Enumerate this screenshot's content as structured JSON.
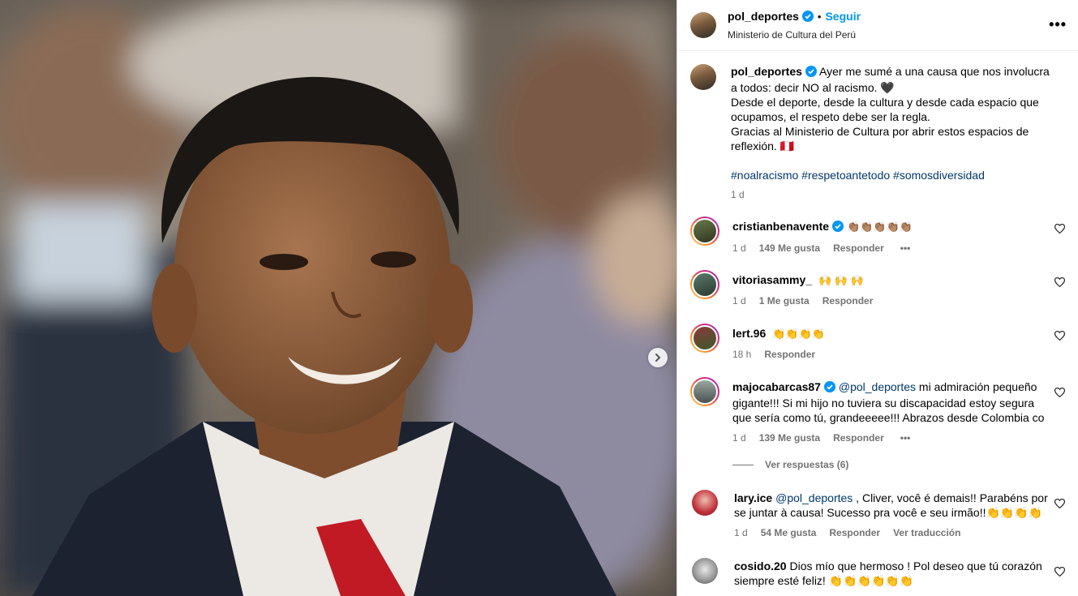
{
  "post": {
    "username": "pol_deportes",
    "follow_label": "Seguir",
    "location": "Ministerio de Cultura del Perú",
    "more_label": "•••"
  },
  "caption": {
    "username": "pol_deportes",
    "line1": "Ayer me sumé a una causa que nos involucra a todos: decir NO al racismo. 🖤",
    "line2": "Desde el deporte, desde la cultura y desde cada espacio que ocupamos, el respeto debe ser la regla.",
    "line3": "Gracias al Ministerio de Cultura por abrir estos espacios de reflexión. 🇵🇪",
    "hashtags": [
      "#noalracismo",
      "#respetoantetodo",
      "#somosdiversidad"
    ],
    "time": "1 d"
  },
  "comments": [
    {
      "username": "cristianbenavente",
      "verified": true,
      "text": "👏🏽👏🏽👏🏽👏🏽👏🏽",
      "time": "1 d",
      "likes": "149 Me gusta",
      "reply": "Responder",
      "more": "•••"
    },
    {
      "username": "vitoriasammy_",
      "verified": false,
      "text": "🙌 🙌 🙌",
      "time": "1 d",
      "likes": "1 Me gusta",
      "reply": "Responder"
    },
    {
      "username": "lert.96",
      "verified": false,
      "text": "👏👏👏👏",
      "time": "18 h",
      "reply": "Responder"
    },
    {
      "username": "majocabarcas87",
      "verified": true,
      "mention": "@pol_deportes",
      "text": " mi admiración pequeño gigante!!! Si mi hijo no tuviera su discapacidad estoy segura que sería como tú, grandeeeee!!! Abrazos desde Colombia co",
      "time": "1 d",
      "likes": "139 Me gusta",
      "reply": "Responder",
      "more": "•••"
    },
    {
      "username": "lary.ice",
      "verified": false,
      "mention": "@pol_deportes",
      "text": " , Cliver, você é demais!! Parabéns por se juntar à causa! Sucesso pra você e seu irmão!!👏👏👏👏",
      "time": "1 d",
      "likes": "54 Me gusta",
      "reply": "Responder",
      "translate": "Ver traducción"
    },
    {
      "username": "cosido.20",
      "verified": false,
      "text": " Dios mío que hermoso ! Pol deseo que tú corazón siempre esté feliz! 👏👏👏👏👏👏"
    }
  ],
  "view_replies": "Ver respuestas (6)",
  "icons": {
    "verified": "verified-badge-icon",
    "heart": "heart-icon",
    "next": "chevron-right-icon",
    "more": "more-options-icon"
  },
  "colors": {
    "link": "#0095f6",
    "hashtag": "#00376b",
    "muted": "#737373",
    "verified": "#0095f6"
  }
}
